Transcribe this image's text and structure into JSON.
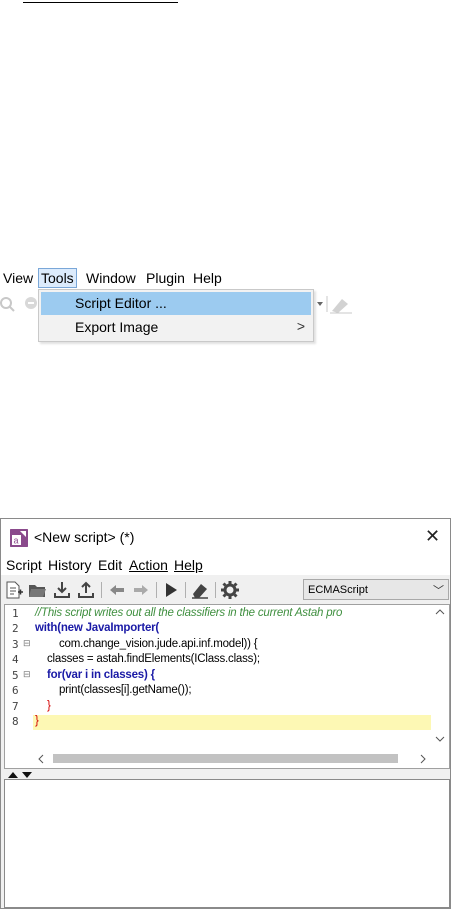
{
  "main_menu": {
    "items": [
      "View",
      "Tools",
      "Window",
      "Plugin",
      "Help"
    ],
    "active": "Tools"
  },
  "tools_menu": {
    "items": [
      {
        "label": "Script Editor ...",
        "highlighted": true,
        "submenu": false
      },
      {
        "label": "Export Image",
        "highlighted": false,
        "submenu": true
      }
    ],
    "submenu_arrow": ">"
  },
  "script_window": {
    "title": "<New script> (*)",
    "close_symbol": "✕",
    "menu": [
      "Script",
      "History",
      "Edit",
      "Action",
      "Help"
    ],
    "toolbar_icons": [
      "new-script-icon",
      "open-icon",
      "download-icon",
      "upload-icon",
      "undo-icon",
      "redo-icon",
      "run-icon",
      "clear-icon",
      "settings-icon"
    ],
    "language": "ECMAScript",
    "line_numbers": [
      "1",
      "2",
      "3",
      "4",
      "5",
      "6",
      "7",
      "8"
    ],
    "code_lines": [
      "//This script writes out all the classifiers in the current Astah pro",
      "with(new JavaImporter(",
      "        com.change_vision.jude.api.inf.model)) {",
      "    classes = astah.findElements(IClass.class);",
      "    for(var i in classes) {",
      "        print(classes[i].getName());",
      "    }",
      "}"
    ],
    "colors": {
      "comment": "#3f8f3f",
      "keyword": "#1a1aa6",
      "highlight_line": "#fdf8b4",
      "app_icon": "#8a4a8c"
    }
  }
}
